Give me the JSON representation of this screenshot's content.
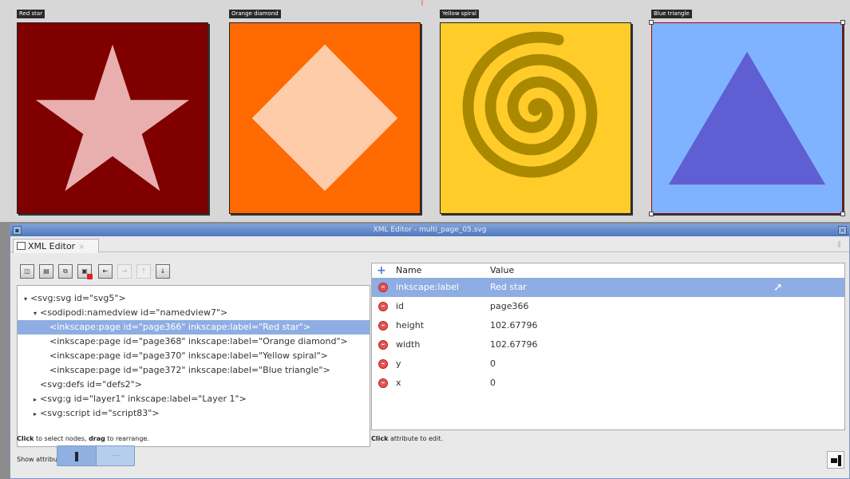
{
  "canvas": {
    "marker": "|",
    "pages": [
      {
        "label": "Red star",
        "shape": "star",
        "bg": "#800000",
        "fg": "#e9afaf"
      },
      {
        "label": "Orange diamond",
        "shape": "diamond",
        "bg": "#ff6a00",
        "fg": "#ffccaa"
      },
      {
        "label": "Yellow spiral",
        "shape": "spiral",
        "bg": "#ffcc2a",
        "fg": "#aa8800"
      },
      {
        "label": "Blue triangle",
        "shape": "triangle",
        "bg": "#80b3ff",
        "fg": "#5f5fd3"
      }
    ]
  },
  "window": {
    "title": "XML Editor - multi_page_05.svg"
  },
  "tab": {
    "label": "XML Editor",
    "close": "×"
  },
  "toolbar": {
    "items": [
      {
        "name": "new-element-node",
        "icon": "new-element-icon",
        "enabled": true
      },
      {
        "name": "new-text-node",
        "icon": "new-text-icon",
        "enabled": true
      },
      {
        "name": "duplicate-node",
        "icon": "duplicate-icon",
        "enabled": true
      },
      {
        "name": "delete-node",
        "icon": "delete-node-icon",
        "enabled": true
      },
      {
        "name": "unindent-node",
        "icon": "unindent-icon",
        "enabled": true
      },
      {
        "name": "indent-node",
        "icon": "indent-icon",
        "enabled": false
      },
      {
        "name": "raise-node",
        "icon": "raise-icon",
        "enabled": false
      },
      {
        "name": "lower-node",
        "icon": "lower-icon",
        "enabled": true
      }
    ]
  },
  "tree": {
    "nodes": [
      {
        "depth": 0,
        "toggle": "▾",
        "text": "<svg:svg id=\"svg5\">",
        "selected": false
      },
      {
        "depth": 1,
        "toggle": "▾",
        "text": "<sodipodi:namedview id=\"namedview7\">",
        "selected": false
      },
      {
        "depth": 2,
        "toggle": "",
        "text": "<inkscape:page id=\"page366\" inkscape:label=\"Red star\">",
        "selected": true
      },
      {
        "depth": 2,
        "toggle": "",
        "text": "<inkscape:page id=\"page368\" inkscape:label=\"Orange diamond\">",
        "selected": false
      },
      {
        "depth": 2,
        "toggle": "",
        "text": "<inkscape:page id=\"page370\" inkscape:label=\"Yellow spiral\">",
        "selected": false
      },
      {
        "depth": 2,
        "toggle": "",
        "text": "<inkscape:page id=\"page372\" inkscape:label=\"Blue triangle\">",
        "selected": false
      },
      {
        "depth": 1,
        "toggle": "",
        "text": "<svg:defs id=\"defs2\">",
        "selected": false
      },
      {
        "depth": 1,
        "toggle": "▸",
        "text": "<svg:g id=\"layer1\" inkscape:label=\"Layer 1\">",
        "selected": false
      },
      {
        "depth": 1,
        "toggle": "▸",
        "text": "<svg:script id=\"script83\">",
        "selected": false
      }
    ],
    "hint_bold_1": "Click",
    "hint_mid": " to select nodes, ",
    "hint_bold_2": "drag",
    "hint_end": " to rearrange."
  },
  "show_attributes": {
    "label": "Show attributes",
    "on_glyph": "❚",
    "off_glyph": "—"
  },
  "attributes": {
    "header_name": "Name",
    "header_value": "Value",
    "add_glyph": "+",
    "rows": [
      {
        "name": "inkscape:label",
        "value": "Red star",
        "selected": true
      },
      {
        "name": "id",
        "value": "page366",
        "selected": false
      },
      {
        "name": "height",
        "value": "102.67796",
        "selected": false
      },
      {
        "name": "width",
        "value": "102.67796",
        "selected": false
      },
      {
        "name": "y",
        "value": "0",
        "selected": false
      },
      {
        "name": "x",
        "value": "0",
        "selected": false
      }
    ],
    "hint_bold": "Click",
    "hint_rest": " attribute to edit."
  }
}
